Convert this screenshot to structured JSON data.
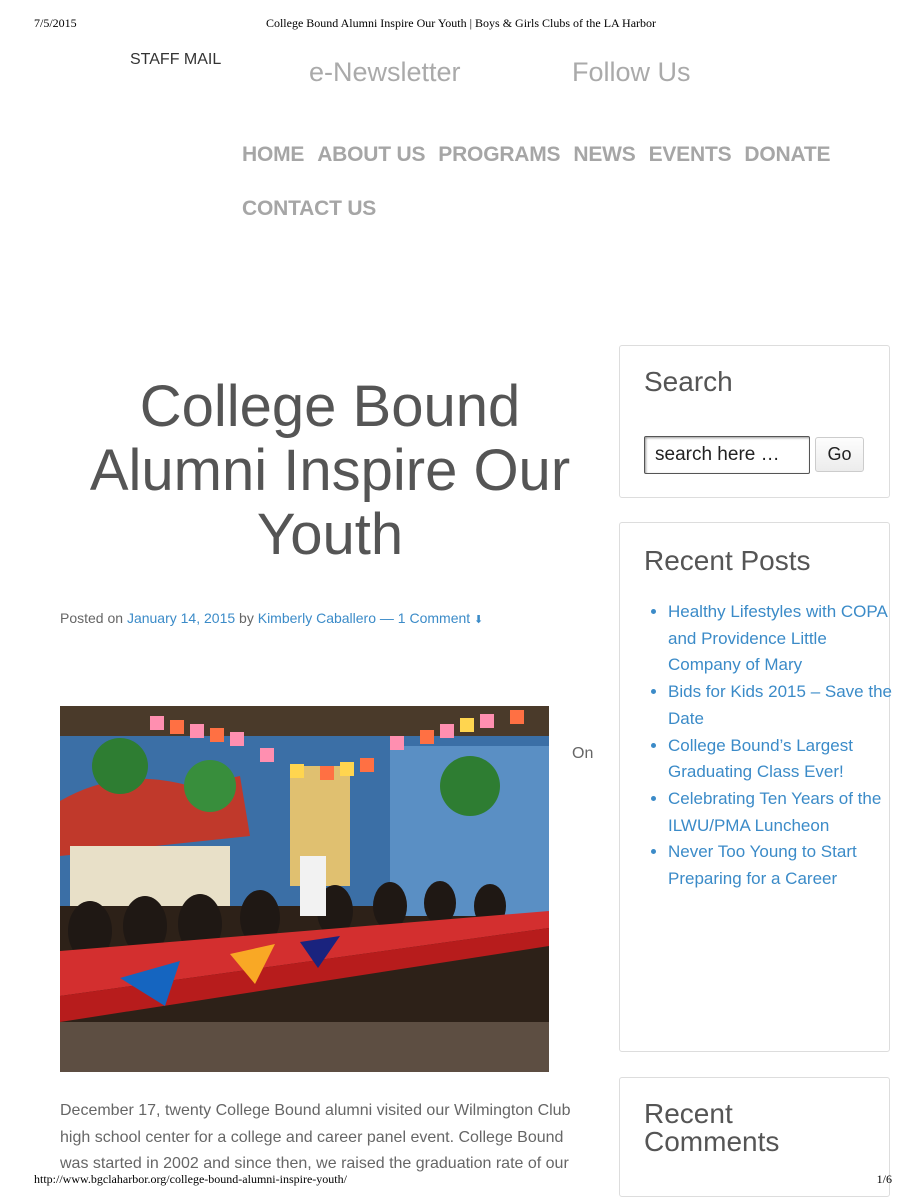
{
  "print_header": {
    "date": "7/5/2015",
    "title": "College Bound Alumni Inspire Our Youth | Boys & Girls Clubs of the LA Harbor"
  },
  "print_footer": {
    "url": "http://www.bgclaharbor.org/college-bound-alumni-inspire-youth/",
    "page": "1/6"
  },
  "top_links": {
    "staff_mail": "STAFF MAIL",
    "enewsletter": "e-Newsletter",
    "follow_us": "Follow Us"
  },
  "nav": {
    "items": [
      "HOME",
      "ABOUT US",
      "PROGRAMS",
      "NEWS",
      "EVENTS",
      "DONATE",
      "CONTACT US"
    ]
  },
  "post": {
    "title": "College Bound Alumni Inspire Our Youth",
    "posted_on": "Posted on",
    "date": "January 14, 2015",
    "by": "by",
    "author": "Kimberly Caballero",
    "separator": "—",
    "comments": "1 Comment",
    "image_alt": "College Bound alumni panel seated at tables with college pennants",
    "on_word": "On",
    "body": "December 17, twenty College Bound alumni visited our Wilmington Club high school center for a college and career panel event. College Bound was started in 2002 and since then, we raised the graduation rate of our"
  },
  "sidebar": {
    "search": {
      "title": "Search",
      "placeholder": "search here …",
      "button": "Go"
    },
    "recent_posts": {
      "title": "Recent Posts",
      "items": [
        "Healthy Lifestyles with COPA and Providence Little Company of Mary",
        "Bids for Kids 2015 – Save the Date",
        "College Bound’s Largest Graduating Class Ever!",
        "Celebrating Ten Years of the ILWU/PMA Luncheon",
        "Never Too Young to Start Preparing for a Career"
      ]
    },
    "recent_comments": {
      "title": "Recent Comments"
    }
  },
  "colors": {
    "link": "#3b8bc8",
    "nav": "#a6a6a6",
    "text": "#555555"
  }
}
